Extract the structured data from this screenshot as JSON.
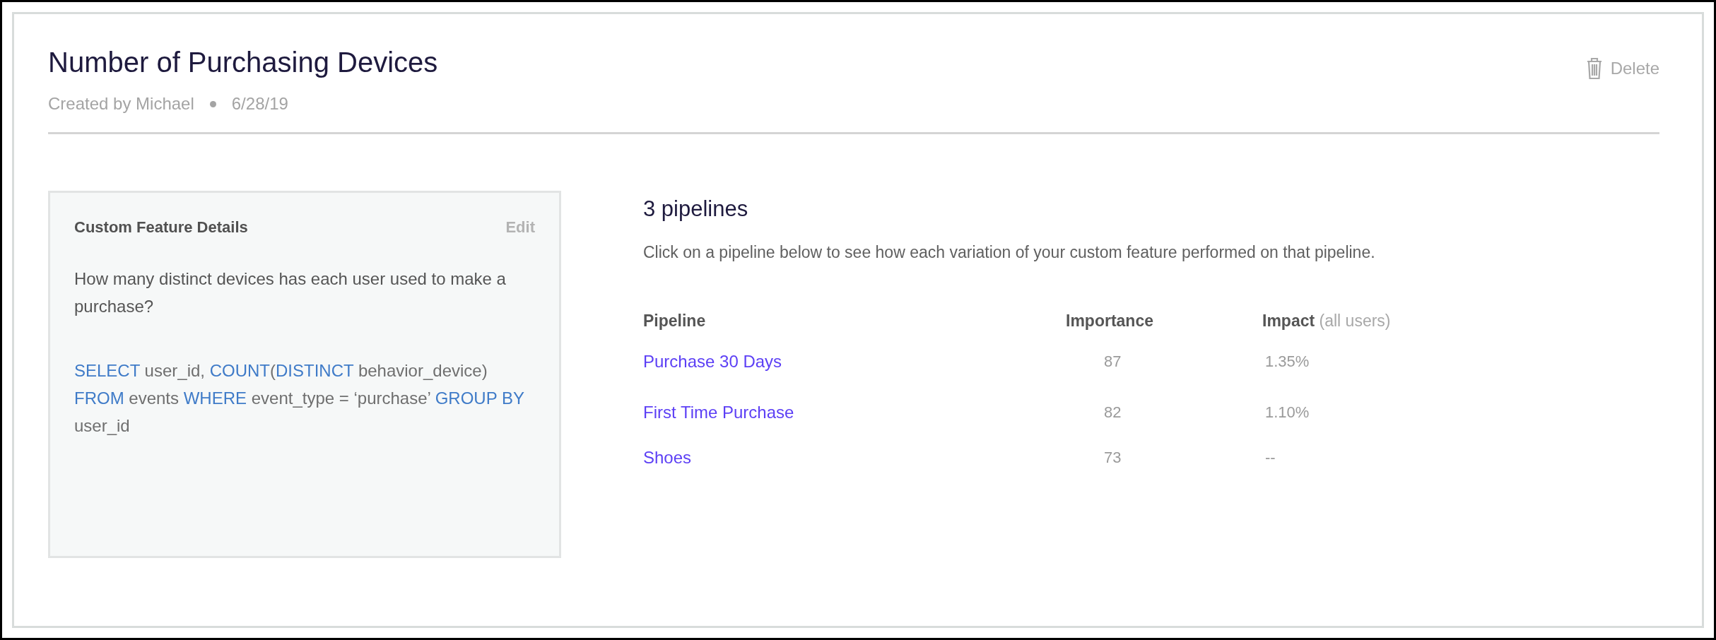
{
  "header": {
    "title": "Number of Purchasing Devices",
    "author": "Created by Michael",
    "date": "6/28/19",
    "delete_label": "Delete"
  },
  "details": {
    "title": "Custom Feature Details",
    "edit_label": "Edit",
    "description": "How many distinct devices has each user used to make a purchase?",
    "sql": [
      {
        "kind": "keyword",
        "text": "SELECT"
      },
      {
        "kind": "plain",
        "text": " user_id, "
      },
      {
        "kind": "keyword",
        "text": "COUNT"
      },
      {
        "kind": "plain",
        "text": "("
      },
      {
        "kind": "keyword",
        "text": "DISTINCT"
      },
      {
        "kind": "plain",
        "text": " behavior_device) "
      },
      {
        "kind": "keyword",
        "text": "FROM"
      },
      {
        "kind": "plain",
        "text": " events "
      },
      {
        "kind": "keyword",
        "text": "WHERE"
      },
      {
        "kind": "plain",
        "text": " event_type = ‘purchase’ "
      },
      {
        "kind": "keyword",
        "text": "GROUP BY"
      },
      {
        "kind": "plain",
        "text": " user_id"
      }
    ]
  },
  "pipelines": {
    "title": "3 pipelines",
    "description": "Click on a pipeline below to see how each variation of your custom feature performed on that pipeline.",
    "columns": [
      {
        "label": "Pipeline"
      },
      {
        "label": "Importance"
      },
      {
        "label": "Impact",
        "note": "(all users)"
      }
    ],
    "rows": [
      {
        "name": "Purchase 30 Days",
        "importance": "87",
        "impact": "1.35%"
      },
      {
        "name": "First Time Purchase",
        "importance": "82",
        "impact": "1.10%"
      },
      {
        "name": "Shoes",
        "importance": "73",
        "impact": "--"
      }
    ]
  }
}
